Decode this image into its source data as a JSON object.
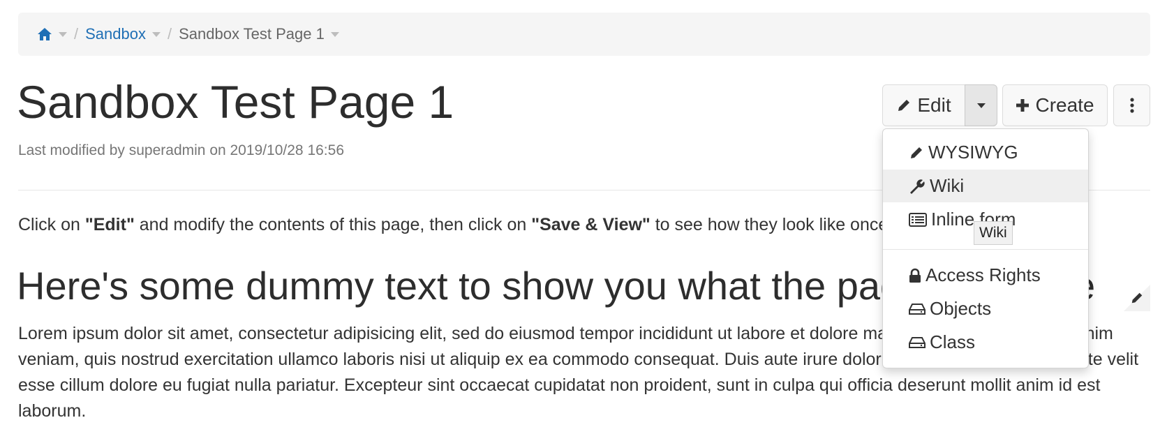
{
  "breadcrumb": {
    "home_icon": "home-icon",
    "items": [
      {
        "label": "Sandbox"
      },
      {
        "label": "Sandbox Test Page 1"
      }
    ]
  },
  "page": {
    "title": "Sandbox Test Page 1",
    "last_modified": "Last modified by superadmin on 2019/10/28 16:56"
  },
  "toolbar": {
    "edit_label": "Edit",
    "create_label": "Create"
  },
  "edit_menu": {
    "items": [
      {
        "label": "WYSIWYG",
        "icon": "pencil-icon"
      },
      {
        "label": "Wiki",
        "icon": "wrench-icon"
      },
      {
        "label": "Inline form",
        "icon": "list-icon"
      },
      {
        "label": "Access Rights",
        "icon": "lock-icon"
      },
      {
        "label": "Objects",
        "icon": "drive-icon"
      },
      {
        "label": "Class",
        "icon": "drive-icon"
      }
    ],
    "tooltip": "Wiki"
  },
  "content": {
    "instr_1": "Click on ",
    "instr_2": "\"Edit\"",
    "instr_3": " and modify the contents of this page, then click on ",
    "instr_4": "\"Save & View\"",
    "instr_5": " to see how they look like once saved.",
    "heading": "Here's some dummy text to show you what the page looks like",
    "lorem": "Lorem ipsum dolor sit amet, consectetur adipisicing elit, sed do eiusmod tempor incididunt ut labore et dolore magna aliqua. Ut enim ad minim veniam, quis nostrud exercitation ullamco laboris nisi ut aliquip ex ea commodo consequat. Duis aute irure dolor in reprehenderit in voluptate velit esse cillum dolore eu fugiat nulla pariatur. Excepteur sint occaecat cupidatat non proident, sunt in culpa qui officia deserunt mollit anim id est laborum."
  },
  "colors": {
    "link": "#1f6fb5",
    "breadcrumb_bg": "#f5f5f5",
    "menu_hover": "#efefef"
  }
}
